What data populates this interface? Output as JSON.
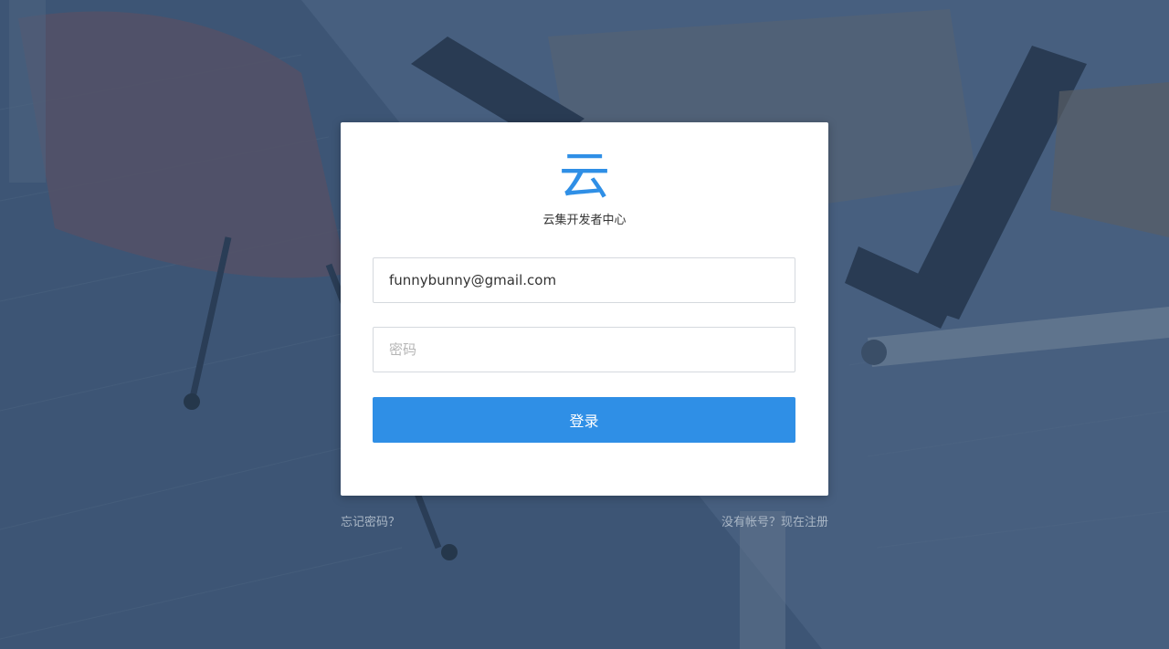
{
  "brand": {
    "logo_glyph": "云",
    "title": "云集开发者中心",
    "accent_color": "#2f8fe6"
  },
  "login_form": {
    "email_value": "funnybunny@gmail.com",
    "password_placeholder": "密码",
    "submit_label": "登录"
  },
  "links": {
    "forgot_password": "忘记密码？",
    "register": "没有帐号？现在注册"
  }
}
